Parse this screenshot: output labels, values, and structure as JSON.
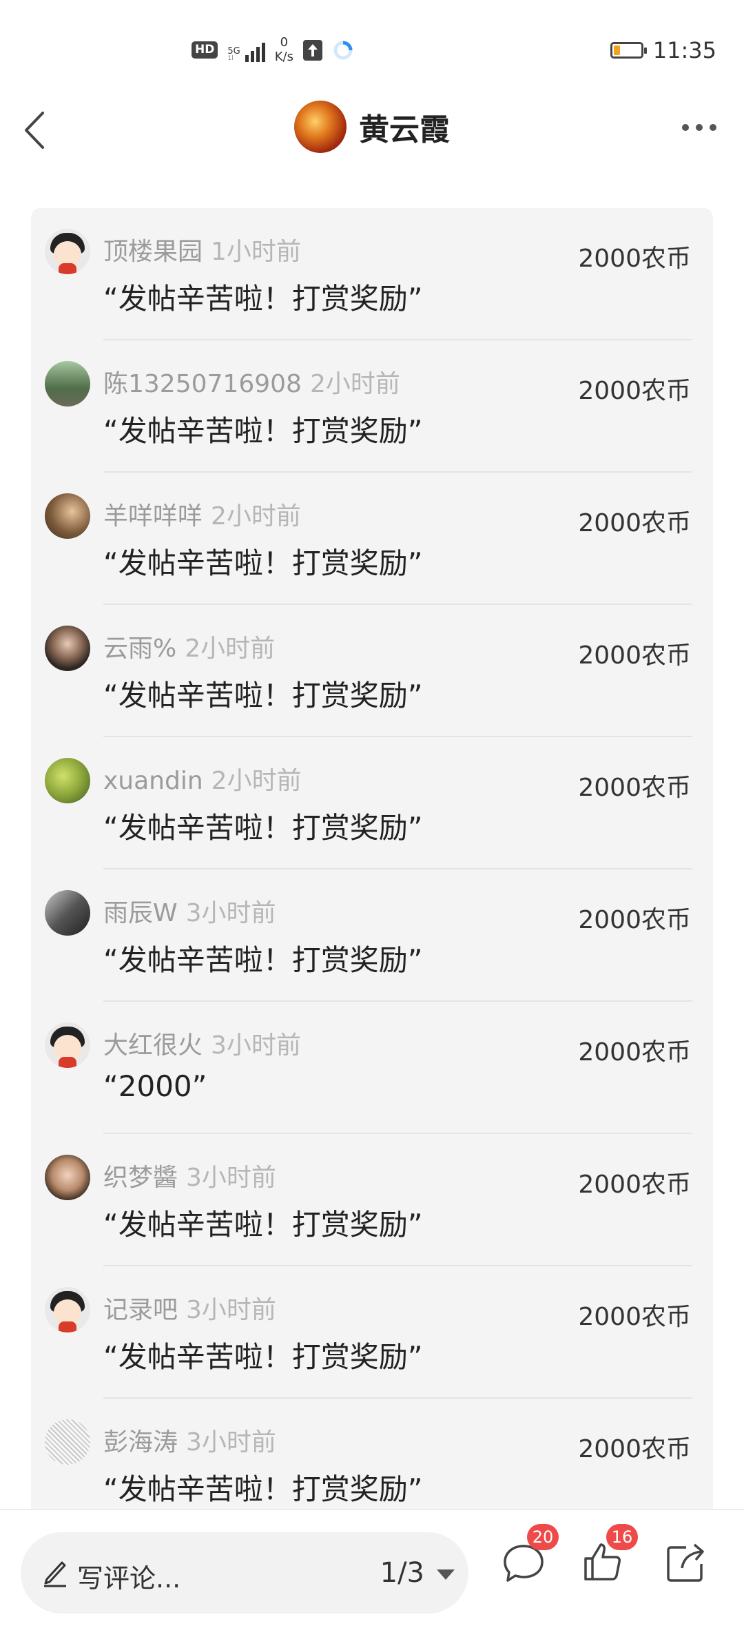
{
  "status_bar": {
    "hd_label": "HD",
    "signal_label_top": "5G",
    "signal_label_bottom": "1l",
    "net_speed_value": "0",
    "net_speed_unit": "K/s",
    "time": "11:35",
    "battery_level": 0.25,
    "battery_color": "#f2a21b"
  },
  "nav": {
    "title": "黄云霞",
    "back_icon": "chevron-left-icon",
    "more_icon": "more-dots-icon"
  },
  "rewards": [
    {
      "name": "顶楼果园",
      "time_ago": "1小时前",
      "message": "“发帖辛苦啦！打赏奖励”",
      "amount": "2000农币",
      "avatar": "cartoon"
    },
    {
      "name": "陈13250716908",
      "time_ago": "2小时前",
      "message": "“发帖辛苦啦！打赏奖励”",
      "amount": "2000农币",
      "avatar": "tree"
    },
    {
      "name": "羊咩咩咩",
      "time_ago": "2小时前",
      "message": "“发帖辛苦啦！打赏奖励”",
      "amount": "2000农币",
      "avatar": "child"
    },
    {
      "name": "云雨%",
      "time_ago": "2小时前",
      "message": "“发帖辛苦啦！打赏奖励”",
      "amount": "2000农币",
      "avatar": "girl"
    },
    {
      "name": "xuandin",
      "time_ago": "2小时前",
      "message": "“发帖辛苦啦！打赏奖励”",
      "amount": "2000农币",
      "avatar": "fruit"
    },
    {
      "name": "雨辰W",
      "time_ago": "3小时前",
      "message": "“发帖辛苦啦！打赏奖励”",
      "amount": "2000农币",
      "avatar": "dark"
    },
    {
      "name": "大红很火",
      "time_ago": "3小时前",
      "message": "“2000”",
      "amount": "2000农币",
      "avatar": "cartoon"
    },
    {
      "name": "织梦醬",
      "time_ago": "3小时前",
      "message": "“发帖辛苦啦！打赏奖励”",
      "amount": "2000农币",
      "avatar": "boy"
    },
    {
      "name": "记录吧",
      "time_ago": "3小时前",
      "message": "“发帖辛苦啦！打赏奖励”",
      "amount": "2000农币",
      "avatar": "cartoon"
    },
    {
      "name": "彭海涛",
      "time_ago": "3小时前",
      "message": "“发帖辛苦啦！打赏奖励”",
      "amount": "2000农币",
      "avatar": "sketch"
    }
  ],
  "bottom_bar": {
    "comment_placeholder": "写评论...",
    "page_indicator": "1/3",
    "comment_count": "20",
    "like_count": "16",
    "accent_color": "#ee4a4a"
  }
}
